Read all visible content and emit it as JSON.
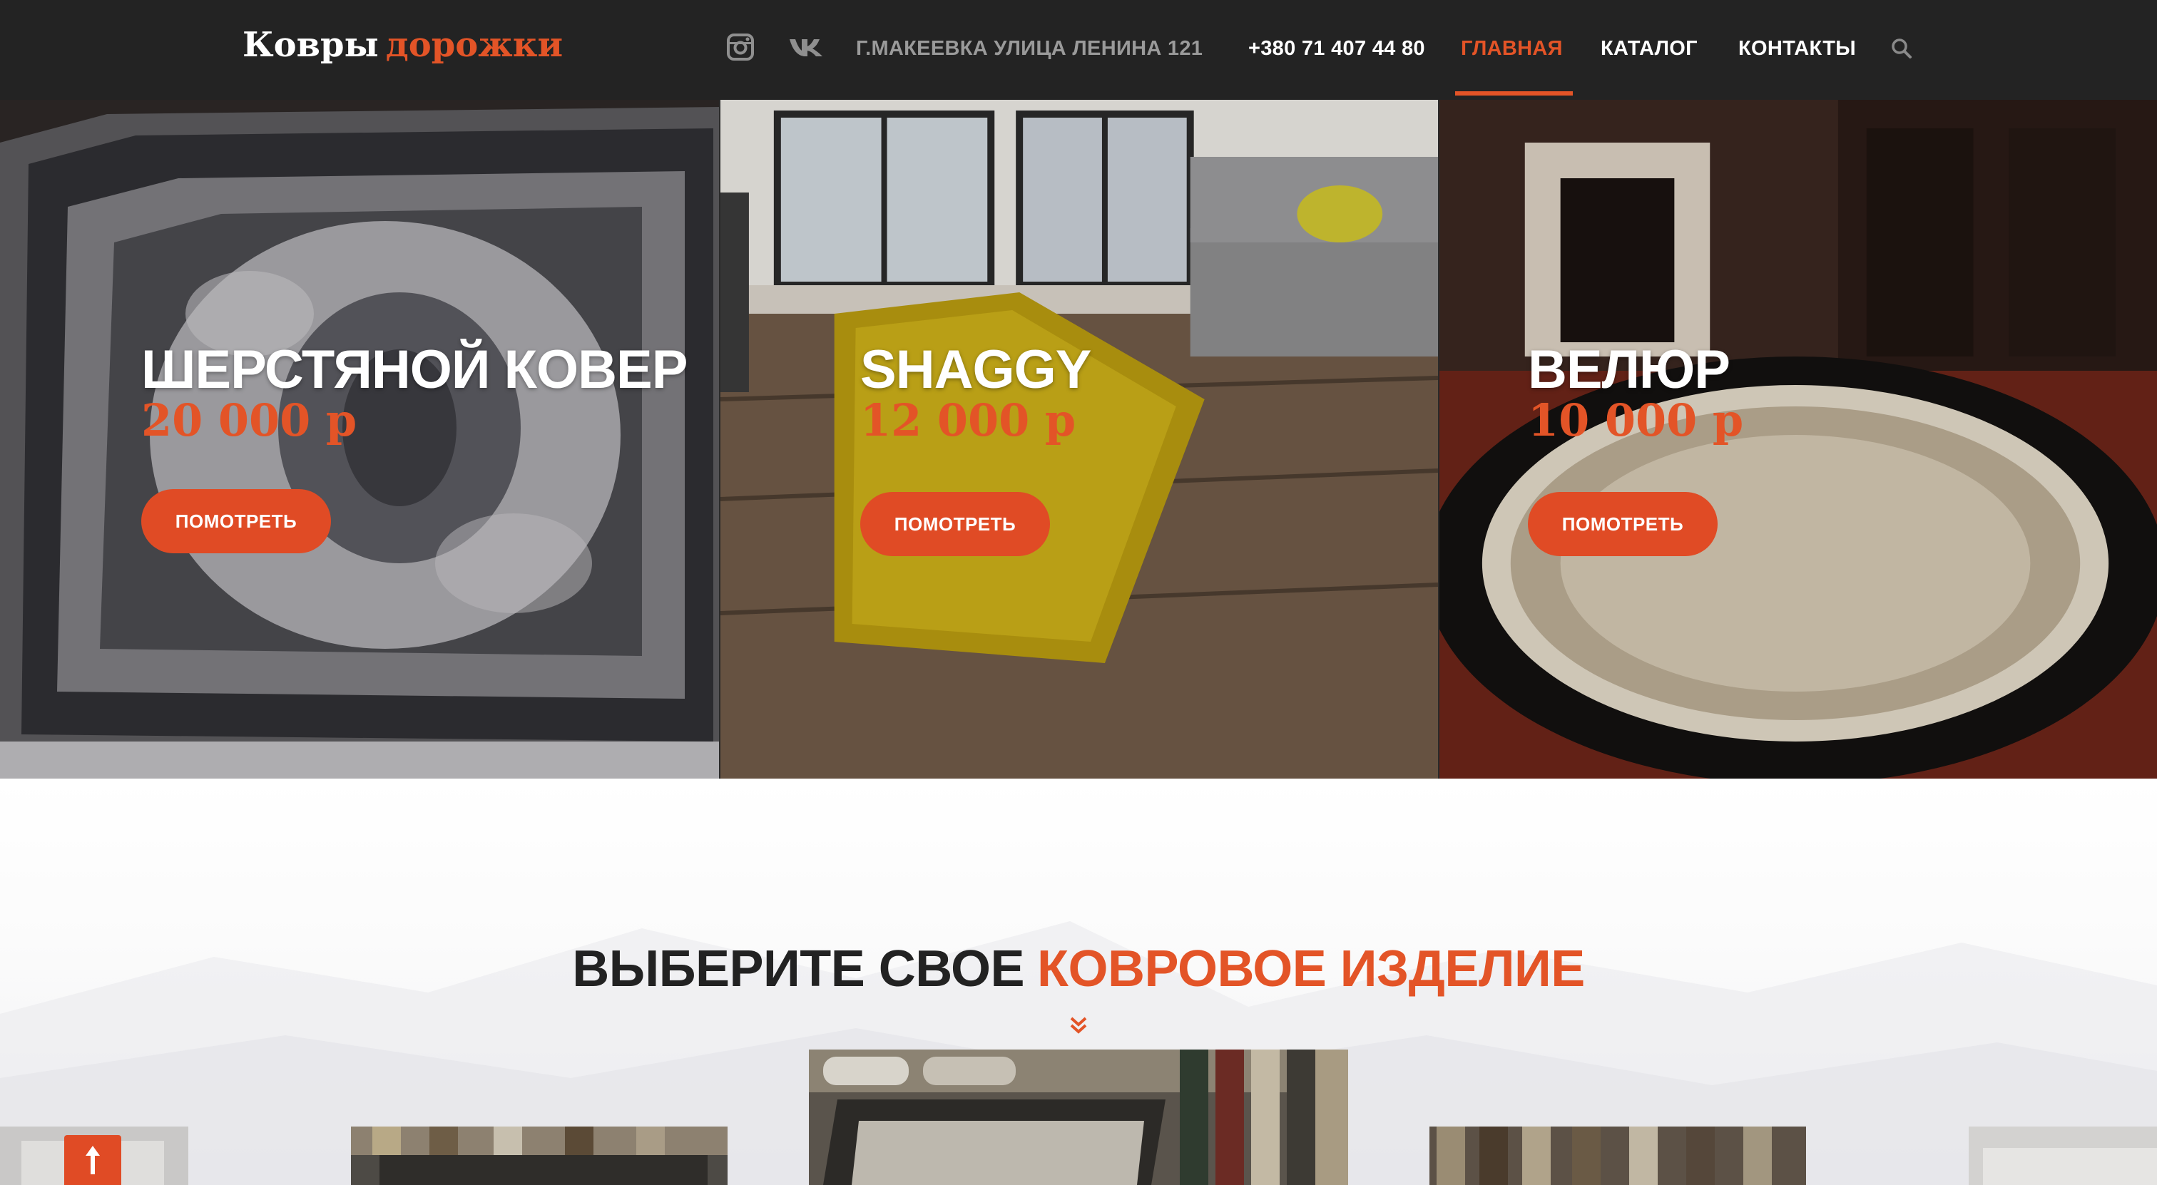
{
  "header": {
    "logo_word1": "Ковры",
    "logo_word2": "дорожки",
    "social": [
      "instagram-icon",
      "vk-icon"
    ],
    "address": "Г.МАКЕЕВКА УЛИЦА ЛЕНИНА 121",
    "phone": "+380 71 407 44 80",
    "nav": [
      {
        "label": "ГЛАВНАЯ",
        "active": true
      },
      {
        "label": "КАТАЛОГ",
        "active": false
      },
      {
        "label": "КОНТАКТЫ",
        "active": false
      }
    ],
    "search_icon": "search-icon"
  },
  "hero": {
    "panels": [
      {
        "title": "ШЕРСТЯНОЙ КОВЕР",
        "price": "20 000 р",
        "button": "ПОМОТРЕТЬ"
      },
      {
        "title": "SHAGGY",
        "price": "12 000 р",
        "button": "ПОМОТРЕТЬ"
      },
      {
        "title": "ВЕЛЮР",
        "price": "10 000 р",
        "button": "ПОМОТРЕТЬ"
      }
    ]
  },
  "section": {
    "title_dark": "ВЫБЕРИТЕ СВОЕ",
    "title_accent": "КОВРОВОЕ ИЗДЕЛИЕ",
    "chevron_icon": "double-chevron-down-icon"
  },
  "scroll_top_icon": "arrow-up-icon",
  "colors": {
    "accent": "#e35427",
    "header_bg": "#232323",
    "button": "#e04b25"
  }
}
